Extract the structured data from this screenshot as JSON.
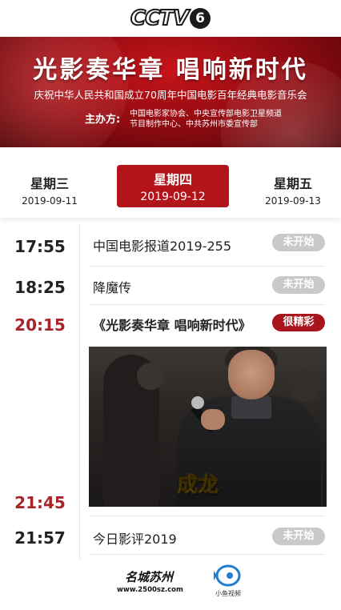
{
  "header": {
    "logo_text": "CCTV",
    "logo_channel": "6"
  },
  "banner": {
    "title": "光影奏华章  唱响新时代",
    "subtitle": "庆祝中华人民共和国成立70周年中国电影百年经典电影音乐会",
    "host_label": "主办方:",
    "host_lines": [
      "中国电影家协会、中央宣传部电影卫星频道",
      "节目制作中心、中共苏州市委宣传部"
    ]
  },
  "dates": [
    {
      "weekday": "星期三",
      "date": "2019-09-11",
      "active": false
    },
    {
      "weekday": "星期四",
      "date": "2019-09-12",
      "active": true
    },
    {
      "weekday": "星期五",
      "date": "2019-09-13",
      "active": false
    }
  ],
  "schedule": [
    {
      "time": "17:55",
      "title": "中国电影报道2019-255",
      "badge": "未开始"
    },
    {
      "time": "18:25",
      "title": "降魔传",
      "badge": "未开始"
    },
    {
      "time": "20:15",
      "title": "《光影奏华章 唱响新时代》",
      "badge": "很精彩"
    },
    {
      "time": "21:45",
      "title": "",
      "badge": ""
    },
    {
      "time": "21:57",
      "title": "今日影评2019",
      "badge": "未开始"
    }
  ],
  "video": {
    "caption": "成龙"
  },
  "footer": {
    "logo1_name": "名城苏州",
    "logo1_url": "www.2500sz.com",
    "logo2_name": "小鱼视频"
  },
  "colors": {
    "accent_red": "#b3141a",
    "badge_gray": "#c9c9c9",
    "time_red": "#a8242b"
  }
}
